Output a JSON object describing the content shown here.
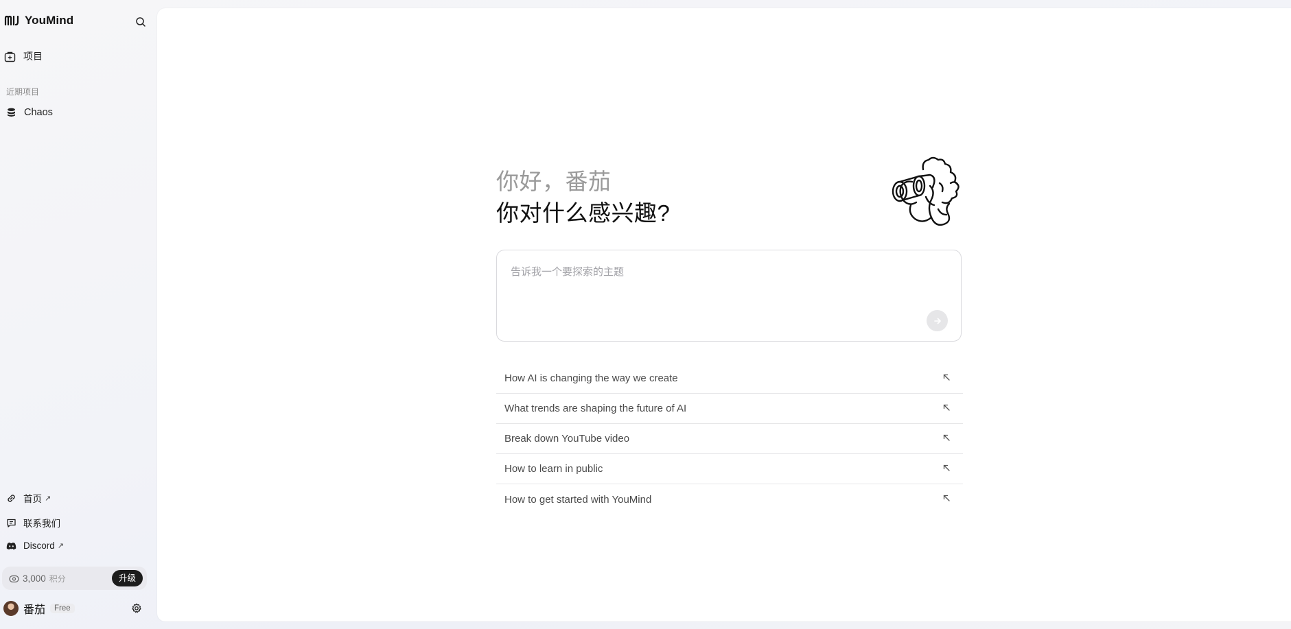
{
  "brand": {
    "name": "YouMind"
  },
  "nav": {
    "projects_label": "项目",
    "recent_section_label": "近期项目",
    "recent_items": [
      {
        "label": "Chaos"
      }
    ]
  },
  "footer": {
    "home_label": "首页",
    "contact_label": "联系我们",
    "discord_label": "Discord",
    "external_arrow": "↗"
  },
  "credits": {
    "amount": "3,000",
    "unit": "积分",
    "upgrade_label": "升级"
  },
  "user": {
    "name": "番茄",
    "plan": "Free"
  },
  "main": {
    "greeting": "你好，番茄",
    "question": "你对什么感兴趣?",
    "prompt_placeholder": "告诉我一个要探索的主题",
    "prompt_value": "",
    "suggestions": [
      {
        "label": "How AI is changing the way we create"
      },
      {
        "label": "What trends are shaping the future of AI"
      },
      {
        "label": "Break down YouTube video"
      },
      {
        "label": "How to learn in public"
      },
      {
        "label": "How to get started with YouMind"
      }
    ]
  },
  "colors": {
    "accent_dark": "#1c1c1c",
    "sidebar_bg": "#f3f3f6",
    "greeting_gray": "#9a9a9a"
  },
  "icons": {
    "brand": "youmind-logo-icon",
    "search": "search-icon",
    "projects": "project-add-icon",
    "recent": "database-stack-icon",
    "home": "link-icon",
    "contact": "chat-icon",
    "discord": "discord-icon",
    "credits": "credits-icon",
    "settings": "gear-icon",
    "send": "arrow-right-icon",
    "suggestion": "arrow-up-left-icon"
  }
}
